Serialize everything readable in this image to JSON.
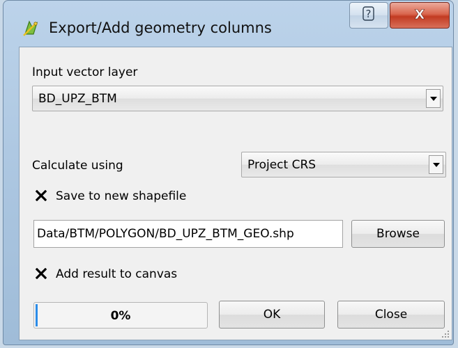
{
  "window": {
    "title": "Export/Add geometry columns",
    "help_glyph": "?",
    "close_glyph": "X"
  },
  "input_layer": {
    "label": "Input vector layer",
    "value": "BD_UPZ_BTM"
  },
  "calculate": {
    "label": "Calculate using",
    "value": "Project CRS"
  },
  "save_new": {
    "label": "Save to new shapefile",
    "checked": true
  },
  "output": {
    "path": "Data/BTM/POLYGON/BD_UPZ_BTM_GEO.shp",
    "browse_label": "Browse"
  },
  "add_canvas": {
    "label": "Add result to canvas",
    "checked": true
  },
  "progress": {
    "text": "0%",
    "value": 0
  },
  "buttons": {
    "ok": "OK",
    "close": "Close"
  },
  "icons": {
    "app": "qgis-geometry-icon",
    "help": "help-icon",
    "close": "close-icon",
    "dropdown": "chevron-down-icon",
    "check": "check-x-icon",
    "grip": "resize-grip-icon"
  },
  "colors": {
    "titlebar": "#a9c4df",
    "close_button": "#c23b22",
    "progress_fill": "#2b8ce8",
    "client_bg": "#f0f0f0"
  }
}
